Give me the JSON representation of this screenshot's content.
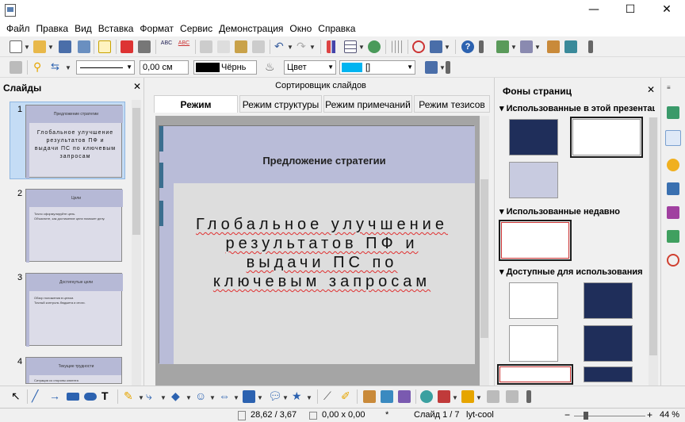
{
  "menu": [
    "Файл",
    "Правка",
    "Вид",
    "Вставка",
    "Формат",
    "Сервис",
    "Демонстрация",
    "Окно",
    "Справка"
  ],
  "window": {
    "minimize": "—",
    "maximize": "☐",
    "close": "✕"
  },
  "toolbar2": {
    "line_width": "0,00 см",
    "line_color": "Чёрнь",
    "area_style": "Цвет",
    "area_color": "[]"
  },
  "slides_panel": {
    "title": "Слайды",
    "close": "✕",
    "slides": [
      {
        "num": "1",
        "title": "Предложение стратегии",
        "body": "Глобальное улучшение результатов ПФ и выдачи ПС по ключевым запросам"
      },
      {
        "num": "2",
        "title": "Цели",
        "bullets": [
          "Точно сформулируйте цель.",
          "Объясните, как достижение цели поможет делу."
        ]
      },
      {
        "num": "3",
        "title": "Достигнутые цели",
        "bullets": [
          "Обзор положения в целом.",
          "Точный контроль бюджета и итоги."
        ]
      },
      {
        "num": "4",
        "title": "Текущие трудности",
        "bullets": [
          "Ситуация со стороны клиента"
        ]
      }
    ]
  },
  "center": {
    "sorter": "Сортировщик слайдов",
    "tabs": [
      "Режим рисования",
      "Режим структуры",
      "Режим примечаний",
      "Режим тезисов"
    ],
    "slide_title": "Предложение стратегии",
    "slide_body": "Глобальное улучшение результатов ПФ и выдачи ПС по ключевым запросам"
  },
  "right_panel": {
    "title": "Фоны страниц",
    "close": "✕",
    "sections": [
      "Использованные в этой презентации",
      "Использованные недавно",
      "Доступные для использования"
    ]
  },
  "status": {
    "position": "28,62 / 3,67",
    "size": "0,00 x 0,00",
    "star": "*",
    "slide": "Слайд 1 / 7",
    "layout": "lyt-cool",
    "zoom": "44 %",
    "zoom_minus": "−",
    "zoom_plus": "+"
  },
  "colors": {
    "accent": "#3b6e8f",
    "slide_band": "#b9bcd8",
    "master_dark": "#1f2e5a",
    "selection": "#c4dcf5"
  }
}
